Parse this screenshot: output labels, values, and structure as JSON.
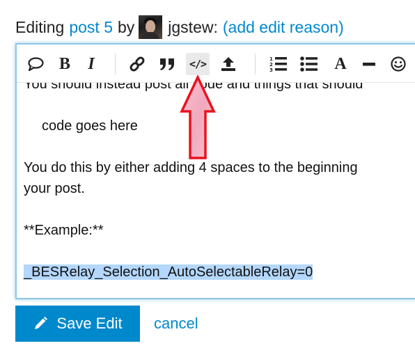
{
  "header": {
    "editing_label": "Editing",
    "post_link": "post 5",
    "by_label": "by",
    "username": "jgstew:",
    "edit_reason_link": "(add edit reason)"
  },
  "toolbar": {
    "buttons": [
      {
        "name": "quote",
        "icon": "speech-bubble-icon"
      },
      {
        "name": "bold",
        "icon": "bold-icon",
        "glyph": "B"
      },
      {
        "name": "italic",
        "icon": "italic-icon",
        "glyph": "I"
      },
      {
        "name": "link",
        "icon": "link-icon"
      },
      {
        "name": "blockquote",
        "icon": "quote-icon"
      },
      {
        "name": "preformatted-text",
        "icon": "code-icon",
        "glyph": "</>",
        "active": true
      },
      {
        "name": "upload",
        "icon": "upload-icon"
      },
      {
        "name": "numbered-list",
        "icon": "ordered-list-icon"
      },
      {
        "name": "bulleted-list",
        "icon": "unordered-list-icon"
      },
      {
        "name": "heading",
        "icon": "heading-icon",
        "glyph": "A"
      },
      {
        "name": "horizontal-rule",
        "icon": "horizontal-rule-icon"
      },
      {
        "name": "emoji",
        "icon": "smiley-icon"
      }
    ]
  },
  "editor": {
    "line_partial": "You should instead post all code and things that should",
    "code_line": "code goes here",
    "line_2a": "You do this by either adding 4 spaces to the beginning",
    "line_2b": "your post.",
    "line_3": "**Example:**",
    "line_4_selected": "_BESRelay_Selection_AutoSelectableRelay=0"
  },
  "actions": {
    "save_label": "Save Edit",
    "cancel_label": "cancel"
  },
  "colors": {
    "link": "#0088cc",
    "primary_button": "#0088cc",
    "selection": "#b3d7fd",
    "arrow_fill": "#f4b6c6",
    "arrow_stroke": "#e8131f"
  }
}
